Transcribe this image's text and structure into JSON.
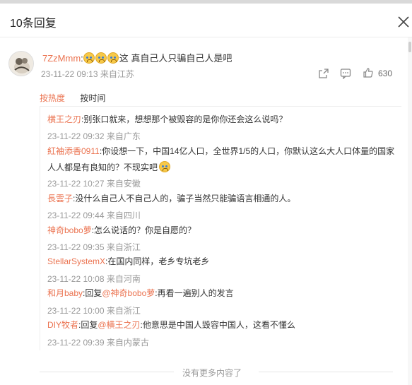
{
  "header": {
    "title": "10条回复"
  },
  "main_comment": {
    "username": "7ZzMmm",
    "separator": ":",
    "emoji_count": 3,
    "text": "这  真自己人只骗自己人是吧",
    "timestamp": "23-11-22 09:13",
    "location": "来自江苏",
    "like_count": "630"
  },
  "sort": {
    "hot_label": "按热度",
    "time_label": "按时间"
  },
  "replies": [
    {
      "username": "横王之刃",
      "text": ":别张口就来，想想那个被毁容的是你你还会这么说吗？",
      "timestamp": "23-11-22 09:32",
      "location": "来自广东"
    },
    {
      "username": "紅袖添香0911",
      "text": ":你设想一下，中国14亿人口，全世界1/5的人口，你默认这么大人口体量的国家人人都是有良知的？不现实吧",
      "timestamp": "23-11-22 10:27",
      "location": "来自安徽"
    },
    {
      "username": "長雲子",
      "text": ":没什么自己人不自己人的，骗子当然只能骗语言相通的人。",
      "timestamp": "23-11-22 09:44",
      "location": "来自四川"
    },
    {
      "username": "神奇bobo萝",
      "text": ":怎么说话的？你是自愿的？",
      "timestamp": "23-11-22 09:35",
      "location": "来自浙江"
    },
    {
      "username": "StellarSystemX",
      "text": ":在国内同样，老乡专坑老乡",
      "timestamp": "23-11-22 10:08",
      "location": "来自河南"
    },
    {
      "username": "和月baby",
      "reply_prefix": ":回复",
      "mention": "@神奇bobo萝",
      "text": ":再看一遍别人的发言",
      "timestamp": "23-11-22 10:00",
      "location": "来自浙江"
    },
    {
      "username": "DIY牧者",
      "reply_prefix": ":回复",
      "mention": "@横王之刃",
      "text": ":他意思是中国人毁容中国人，这看不懂么",
      "timestamp": "23-11-22 09:39",
      "location": "来自内蒙古"
    }
  ],
  "footer": {
    "text": "没有更多内容了"
  },
  "icons": {
    "close": "close-icon",
    "share": "share-icon",
    "comment": "comment-icon",
    "like": "thumbs-up-icon",
    "emoji": "crying-laugh-emoji-icon"
  },
  "colors": {
    "accent": "#eb7350",
    "meta": "#999999",
    "text": "#333333"
  }
}
